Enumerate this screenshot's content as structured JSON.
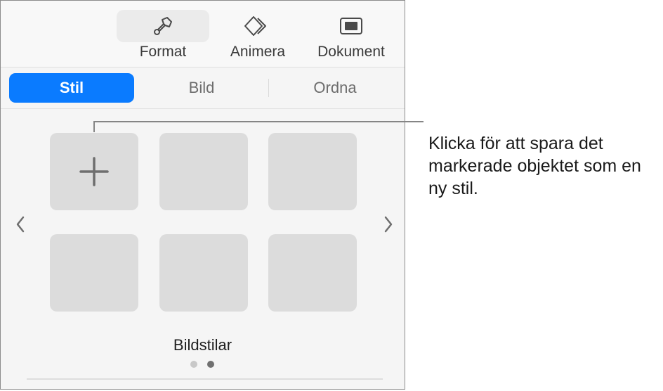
{
  "toolbar": {
    "items": [
      {
        "label": "Format",
        "icon": "paintbrush-icon",
        "active": true
      },
      {
        "label": "Animera",
        "icon": "animate-diamonds-icon",
        "active": false
      },
      {
        "label": "Dokument",
        "icon": "document-icon",
        "active": false
      }
    ]
  },
  "tabs": [
    {
      "label": "Stil",
      "selected": true
    },
    {
      "label": "Bild",
      "selected": false
    },
    {
      "label": "Ordna",
      "selected": false
    }
  ],
  "styles": {
    "section_label": "Bildstilar",
    "tiles": [
      {
        "type": "add",
        "icon": "plus-icon"
      },
      {
        "type": "style"
      },
      {
        "type": "style"
      },
      {
        "type": "style"
      },
      {
        "type": "style"
      },
      {
        "type": "style"
      }
    ],
    "prev_icon": "chevron-left-icon",
    "next_icon": "chevron-right-icon",
    "page_count": 2,
    "current_page": 2
  },
  "callout": {
    "text": "Klicka för att spara det markerade objektet som en ny stil."
  },
  "colors": {
    "accent": "#0a7bff",
    "tile": "#dcdcdc",
    "dot_inactive": "#c8c8c8",
    "dot_active": "#707070"
  }
}
